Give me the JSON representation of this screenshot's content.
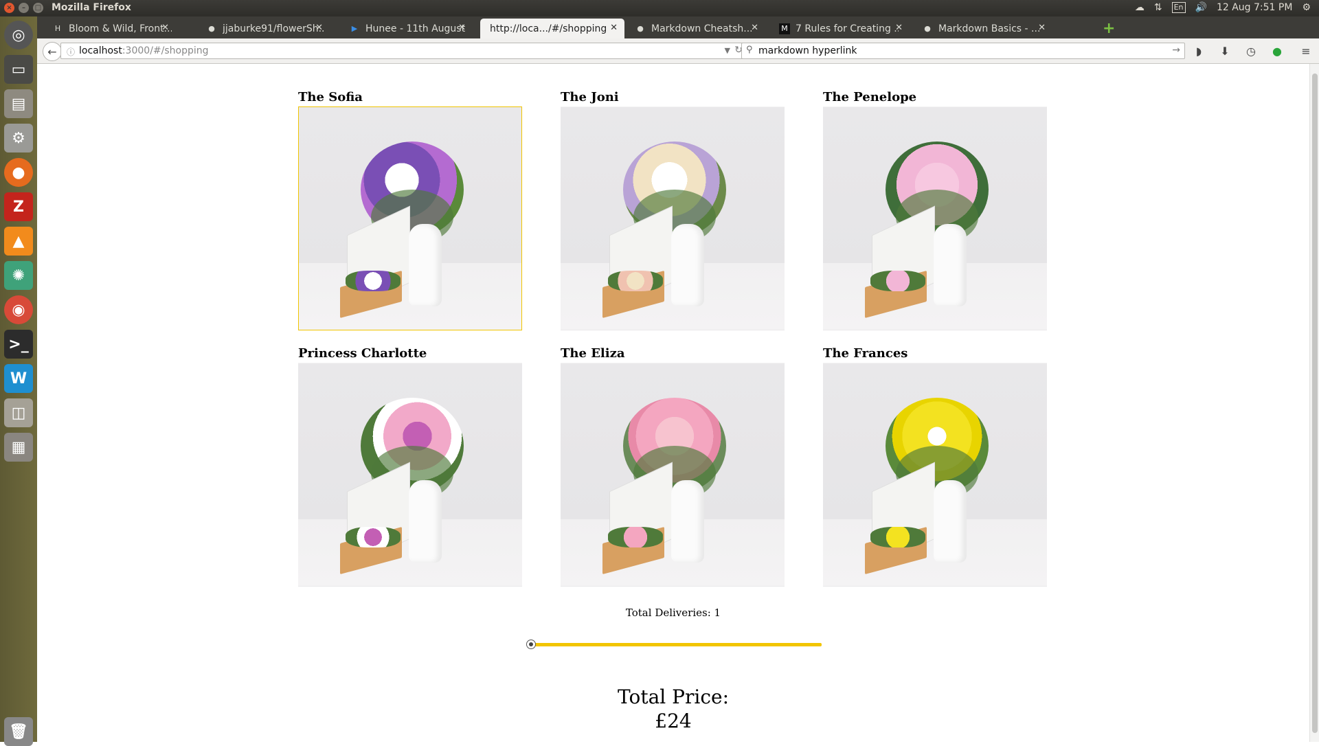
{
  "os_panel": {
    "window_title": "Mozilla Firefox",
    "keyboard_layout": "En",
    "clock": "12 Aug  7:51 PM"
  },
  "browser": {
    "tabs": [
      {
        "label": "Bloom & Wild, Front...",
        "icon": "H",
        "active": false
      },
      {
        "label": "jjaburke91/flowerSh...",
        "icon": "github-icon",
        "active": false
      },
      {
        "label": "Hunee - 11th August ...",
        "icon": "play-icon",
        "active": false
      },
      {
        "label": "http://loca.../#/shopping",
        "icon": "",
        "active": true
      },
      {
        "label": "Markdown Cheatsh...",
        "icon": "github-icon",
        "active": false
      },
      {
        "label": "7 Rules for Creating ...",
        "icon": "M",
        "active": false
      },
      {
        "label": "Markdown Basics - ...",
        "icon": "github-icon",
        "active": false
      }
    ],
    "url_host": "localhost",
    "url_path": ":3000/#/shopping",
    "search_value": "markdown hyperlink"
  },
  "shop": {
    "flowers": [
      {
        "name": "The Sofia",
        "selected": true,
        "colors": [
          "#7a4fb5",
          "#ffffff",
          "#b46bd1"
        ]
      },
      {
        "name": "The Joni",
        "selected": false,
        "colors": [
          "#f2e3c4",
          "#ffffff",
          "#b9a3d6"
        ]
      },
      {
        "name": "The Penelope",
        "selected": false,
        "colors": [
          "#f2b6d6",
          "#f7c8e0",
          "#e89cc8"
        ]
      },
      {
        "name": "Princess Charlotte",
        "selected": false,
        "colors": [
          "#f2a9c9",
          "#c35fb4",
          "#ffffff"
        ]
      },
      {
        "name": "The Eliza",
        "selected": false,
        "colors": [
          "#f4a6c0",
          "#f7c3cf",
          "#e88aa8"
        ]
      },
      {
        "name": "The Frances",
        "selected": false,
        "colors": [
          "#f3e220",
          "#e8d400",
          "#ffffff"
        ]
      }
    ],
    "total_deliveries_text": "Total Deliveries: 1",
    "deliveries_slider_value": 1,
    "total_price_label": "Total Price:",
    "total_price_value": "£24",
    "accent_color": "#f2c500"
  }
}
